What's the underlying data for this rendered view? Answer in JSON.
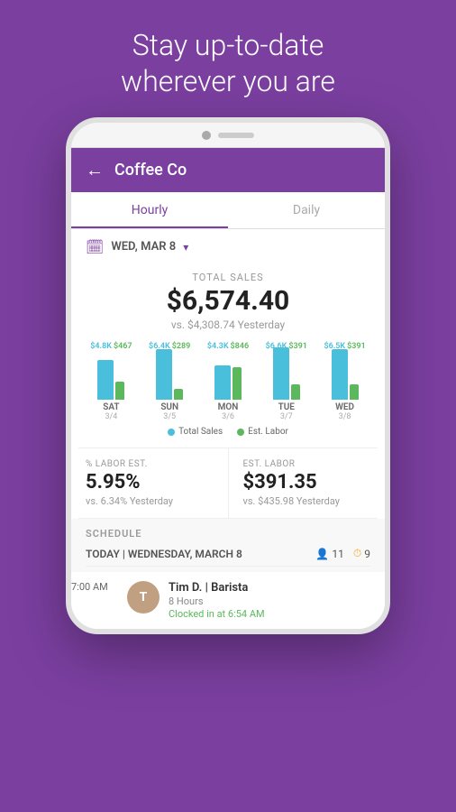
{
  "headline": {
    "line1": "Stay up-to-date",
    "line2": "wherever you are"
  },
  "app": {
    "back_label": "←",
    "title": "Coffee Co"
  },
  "tabs": [
    {
      "label": "Hourly",
      "active": true
    },
    {
      "label": "Daily",
      "active": false
    }
  ],
  "date_row": {
    "date": "WED, MAR 8",
    "icon": "📅"
  },
  "sales": {
    "label": "TOTAL SALES",
    "value": "$6,574.40",
    "vs": "vs. $4,308.74 Yesterday"
  },
  "chart": {
    "bars": [
      {
        "day": "SAT",
        "date": "3/4",
        "top_blue": "$4.8K",
        "top_green": "$467",
        "height_blue": 44,
        "height_green": 20
      },
      {
        "day": "SUN",
        "date": "3/5",
        "top_blue": "$6.4K",
        "top_green": "$289",
        "height_blue": 56,
        "height_green": 12
      },
      {
        "day": "MON",
        "date": "3/6",
        "top_blue": "$4.3K",
        "top_green": "$846",
        "height_blue": 38,
        "height_green": 36
      },
      {
        "day": "TUE",
        "date": "3/7",
        "top_blue": "$6.6K",
        "top_green": "$391",
        "height_blue": 58,
        "height_green": 17
      },
      {
        "day": "WED",
        "date": "3/8",
        "top_blue": "$6.5K",
        "top_green": "$391",
        "height_blue": 56,
        "height_green": 17
      }
    ],
    "legend": {
      "total_sales": "Total Sales",
      "est_labor": "Est. Labor"
    }
  },
  "metrics": [
    {
      "label": "% LABOR EST.",
      "value": "5.95%",
      "vs": "vs. 6.34% Yesterday"
    },
    {
      "label": "EST. LABOR",
      "value": "$391.35",
      "vs": "vs. $435.98 Yesterday"
    }
  ],
  "schedule": {
    "title": "SCHEDULE",
    "date_label": "TODAY | WEDNESDAY, MARCH 8",
    "people_count": "11",
    "clock_count": "9",
    "entries": [
      {
        "time": "7:00 AM",
        "name": "Tim D.",
        "role": "Barista",
        "duration": "8 Hours",
        "status": "Clocked in at 6:54 AM",
        "avatar_initials": "T"
      }
    ]
  }
}
